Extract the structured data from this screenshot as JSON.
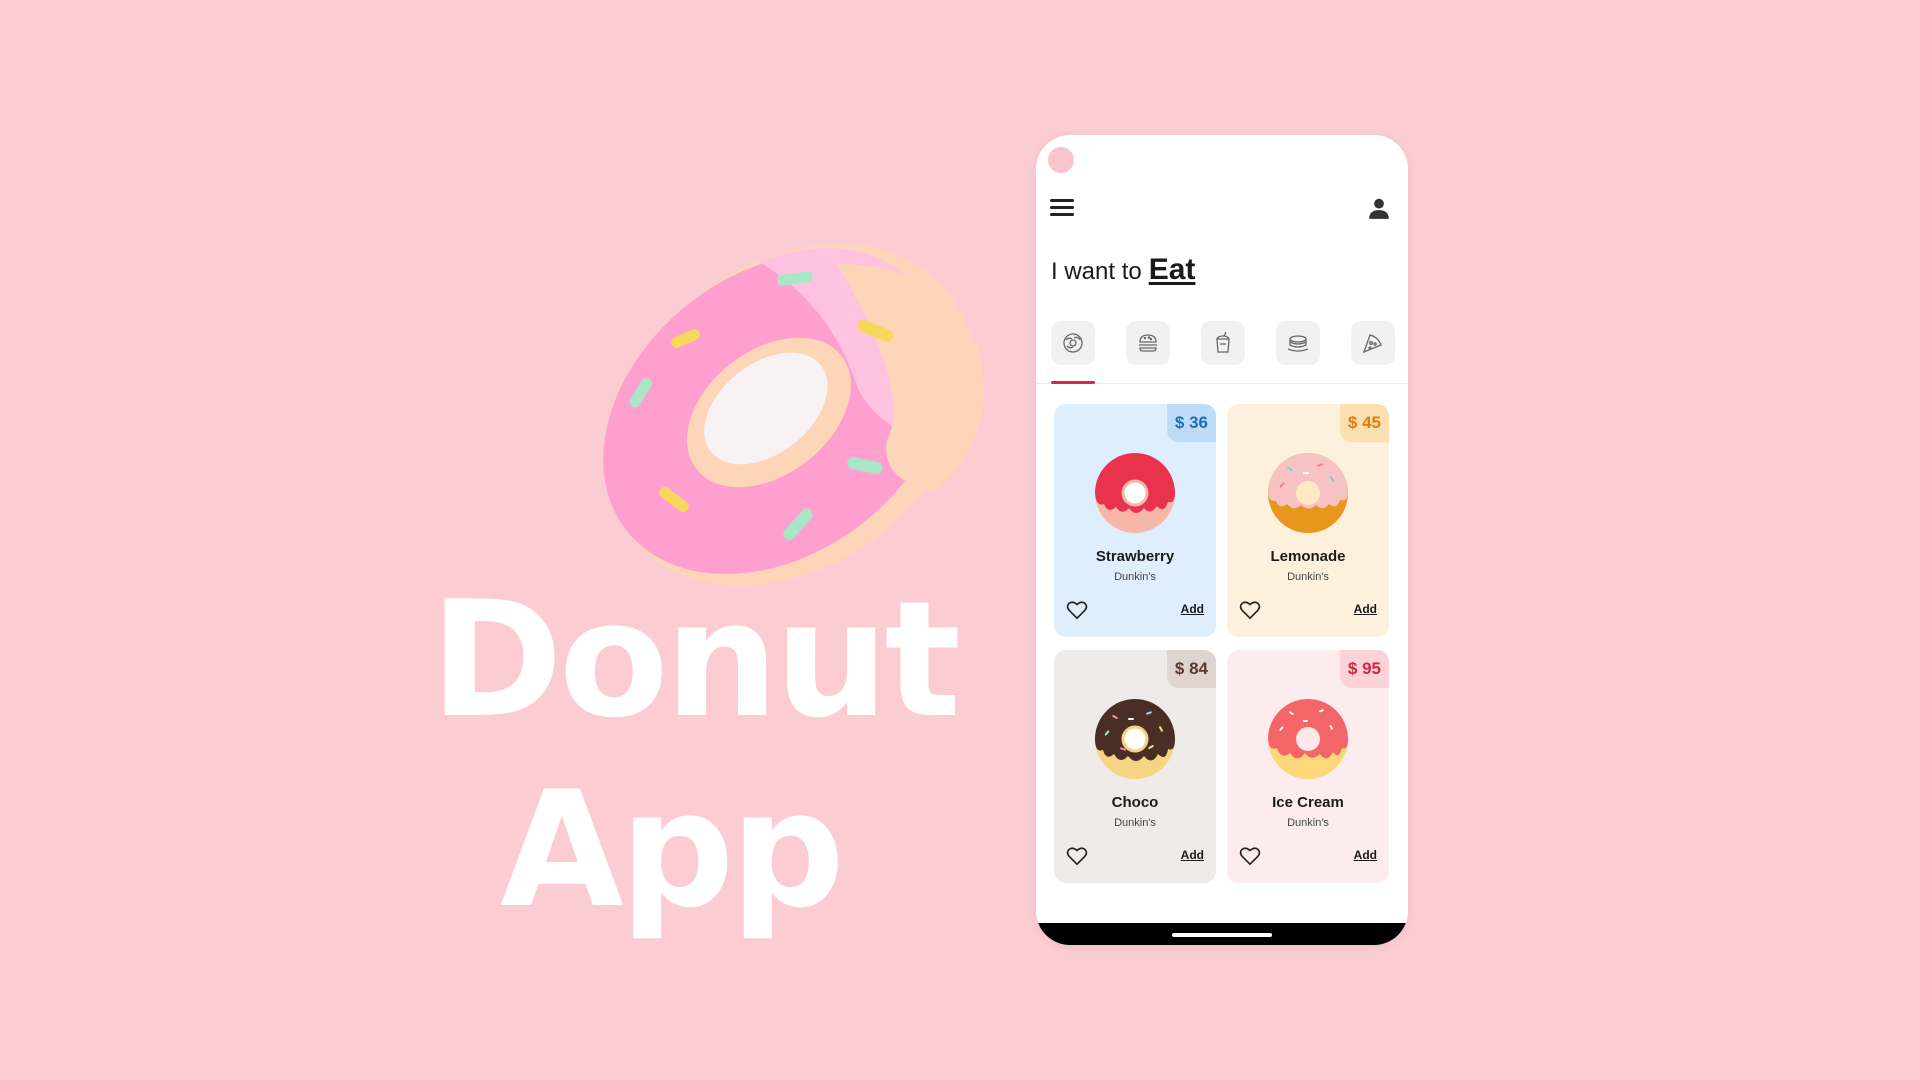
{
  "hero": {
    "title_line_1": "Donut",
    "title_line_2": "App"
  },
  "colors": {
    "background": "#fcccd3",
    "accent": "#d6264a"
  },
  "header": {
    "menu_icon": "hamburger-menu-icon",
    "profile_icon": "person-icon",
    "headline_prefix": "I want to",
    "headline_strong": "Eat"
  },
  "categories": [
    {
      "name": "donut",
      "icon": "donut-icon",
      "selected": true
    },
    {
      "name": "burger",
      "icon": "burger-icon",
      "selected": false
    },
    {
      "name": "smoothie",
      "icon": "smoothie-icon",
      "selected": false
    },
    {
      "name": "pancake",
      "icon": "pancake-icon",
      "selected": false
    },
    {
      "name": "pizza",
      "icon": "pizza-icon",
      "selected": false
    }
  ],
  "products": [
    {
      "price": "$ 36",
      "name": "Strawberry",
      "brand": "Dunkin's",
      "add_label": "Add",
      "card_color": "#dfeefc",
      "tag_color": "#bcdcf7",
      "price_color": "#1f6fb8"
    },
    {
      "price": "$ 45",
      "name": "Lemonade",
      "brand": "Dunkin's",
      "add_label": "Add",
      "card_color": "#fdf1dd",
      "tag_color": "#fbdfb0",
      "price_color": "#e07d0f"
    },
    {
      "price": "$ 84",
      "name": "Choco",
      "brand": "Dunkin's",
      "add_label": "Add",
      "card_color": "#efebe8",
      "tag_color": "#dfd4cf",
      "price_color": "#5a3a30"
    },
    {
      "price": "$ 95",
      "name": "Ice Cream",
      "brand": "Dunkin's",
      "add_label": "Add",
      "card_color": "#fdecee",
      "tag_color": "#fbd2d8",
      "price_color": "#d0283f"
    }
  ]
}
